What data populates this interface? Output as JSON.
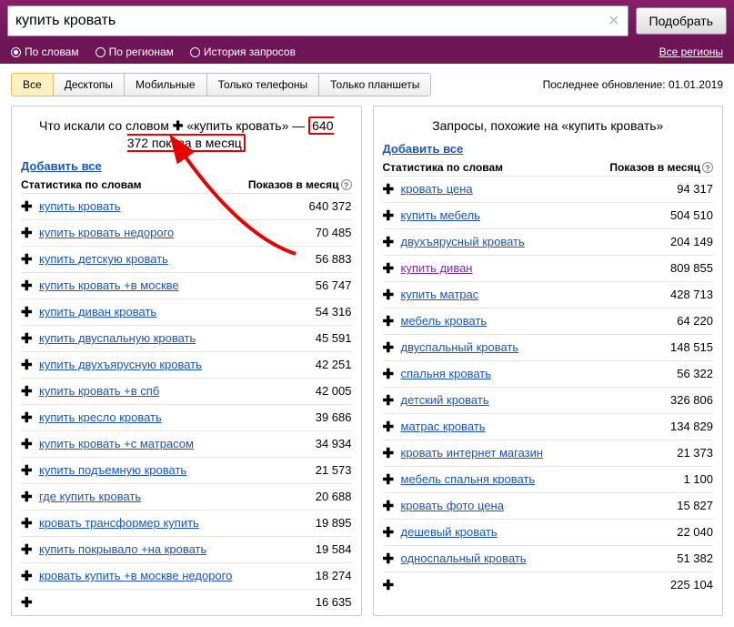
{
  "search": {
    "value": "купить кровать",
    "button": "Подобрать"
  },
  "subnav": {
    "options": [
      "По словам",
      "По регионам",
      "История запросов"
    ],
    "selected": 0,
    "regions_link": "Все регионы"
  },
  "tabs": {
    "items": [
      "Все",
      "Десктопы",
      "Мобильные",
      "Только телефоны",
      "Только планшеты"
    ],
    "active": 0,
    "update_label": "Последнее обновление: 01.01.2019"
  },
  "left": {
    "title_prefix": "Что искали со словом",
    "title_query": "«купить кровать»",
    "title_dash": " — ",
    "title_highlight": "640 372 показа в месяц",
    "add_all": "Добавить все",
    "header_left": "Статистика по словам",
    "header_right": "Показов в месяц",
    "rows": [
      {
        "kw": "купить кровать",
        "cnt": "640 372"
      },
      {
        "kw": "купить кровать недорого",
        "cnt": "70 485"
      },
      {
        "kw": "купить детскую кровать",
        "cnt": "56 883"
      },
      {
        "kw": "купить кровать +в москве",
        "cnt": "56 747"
      },
      {
        "kw": "купить диван кровать",
        "cnt": "54 316"
      },
      {
        "kw": "купить двуспальную кровать",
        "cnt": "45 591"
      },
      {
        "kw": "купить двухъярусную кровать",
        "cnt": "42 251"
      },
      {
        "kw": "купить кровать +в спб",
        "cnt": "42 005"
      },
      {
        "kw": "купить кресло кровать",
        "cnt": "39 686"
      },
      {
        "kw": "купить кровать +с матрасом",
        "cnt": "34 934"
      },
      {
        "kw": "купить подъемную кровать",
        "cnt": "21 573"
      },
      {
        "kw": "где купить кровать",
        "cnt": "20 688"
      },
      {
        "kw": "кровать трансформер купить",
        "cnt": "19 895"
      },
      {
        "kw": "купить покрывало +на кровать",
        "cnt": "19 584"
      },
      {
        "kw": "кровать купить +в москве недорого",
        "cnt": "18 274"
      },
      {
        "kw": "",
        "cnt": "16 635"
      }
    ]
  },
  "right": {
    "title": "Запросы, похожие на «купить кровать»",
    "add_all": "Добавить все",
    "header_left": "Статистика по словам",
    "header_right": "Показов в месяц",
    "rows": [
      {
        "kw": "кровать цена",
        "cnt": "94 317"
      },
      {
        "kw": "купить мебель",
        "cnt": "504 510"
      },
      {
        "kw": "двухъярусный кровать",
        "cnt": "204 149"
      },
      {
        "kw": "купить диван",
        "cnt": "809 855",
        "visited": true
      },
      {
        "kw": "купить матрас",
        "cnt": "428 713"
      },
      {
        "kw": "мебель кровать",
        "cnt": "64 220"
      },
      {
        "kw": "двуспальный кровать",
        "cnt": "148 515"
      },
      {
        "kw": "спальня кровать",
        "cnt": "56 322"
      },
      {
        "kw": "детский кровать",
        "cnt": "326 806"
      },
      {
        "kw": "матрас кровать",
        "cnt": "134 829"
      },
      {
        "kw": "кровать интернет магазин",
        "cnt": "21 373"
      },
      {
        "kw": "мебель спальня кровать",
        "cnt": "1 100"
      },
      {
        "kw": "кровать фото цена",
        "cnt": "15 827"
      },
      {
        "kw": "дешевый кровать",
        "cnt": "22 040"
      },
      {
        "kw": "односпальный кровать",
        "cnt": "51 382"
      },
      {
        "kw": "",
        "cnt": "225 104"
      }
    ]
  }
}
